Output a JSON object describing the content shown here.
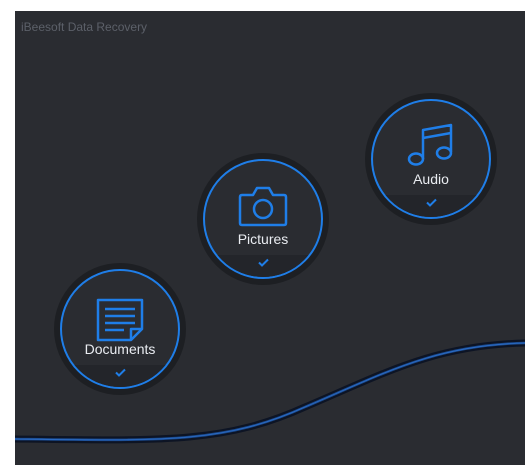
{
  "app": {
    "title": "iBeesoft Data Recovery"
  },
  "colors": {
    "background": "#2a2c31",
    "accent": "#1f7ee8",
    "outer_ring": "#1d1f23",
    "label_text": "#e9ecf1"
  },
  "categories": [
    {
      "label": "Documents",
      "icon": "document-icon",
      "selected": true
    },
    {
      "label": "Pictures",
      "icon": "camera-icon",
      "selected": true
    },
    {
      "label": "Audio",
      "icon": "music-note-icon",
      "selected": true
    }
  ]
}
